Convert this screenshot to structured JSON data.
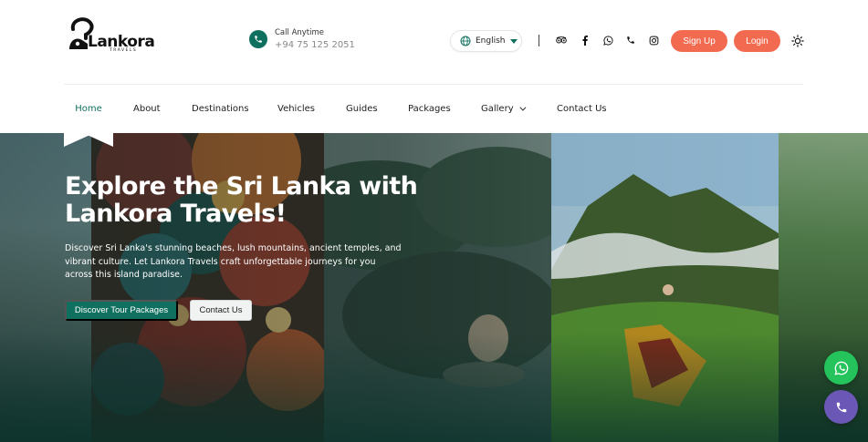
{
  "brand": {
    "name": "Lankora",
    "tagline": "TRAVELS"
  },
  "contact": {
    "label": "Call Anytime",
    "phone": "+94 75 125 2051"
  },
  "language": {
    "selected": "English"
  },
  "auth": {
    "signup_label": "Sign Up",
    "login_label": "Login"
  },
  "social_icons": [
    "tripadvisor-icon",
    "facebook-icon",
    "whatsapp-icon",
    "phone-icon",
    "instagram-icon"
  ],
  "nav": {
    "items": [
      {
        "label": "Home",
        "active": true
      },
      {
        "label": "About"
      },
      {
        "label": "Destinations"
      },
      {
        "label": "Vehicles"
      },
      {
        "label": "Guides"
      },
      {
        "label": "Packages"
      },
      {
        "label": "Gallery",
        "has_dropdown": true
      },
      {
        "label": "Contact Us"
      }
    ]
  },
  "hero": {
    "title_line1": "Explore the Sri Lanka with",
    "title_line2": "Lankora Travels!",
    "description": "Discover Sri Lanka's stunning beaches, lush mountains, ancient temples, and vibrant culture. Let Lankora Travels craft unforgettable journeys for you across this island paradise.",
    "primary_button": "Discover Tour Packages",
    "secondary_button": "Contact Us"
  },
  "floating": {
    "whatsapp": "whatsapp-icon",
    "call": "phone-icon"
  },
  "colors": {
    "brand_green": "#10705f",
    "accent_orange": "#f26a50",
    "whatsapp_green": "#25c35b",
    "call_purple": "#6b57b6"
  }
}
